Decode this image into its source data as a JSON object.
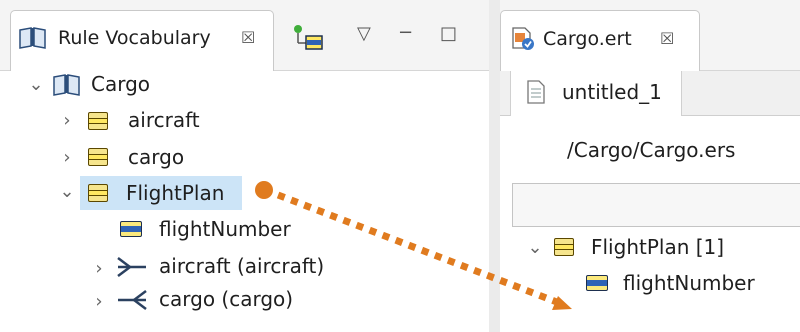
{
  "left_view": {
    "tab_title": "Rule Vocabulary",
    "tab_close": "☒",
    "toolbar": {
      "menu": "▽",
      "minimize": "−",
      "maximize": "□"
    },
    "tree": [
      {
        "label": "Cargo",
        "expanded": true
      },
      {
        "label": "aircraft",
        "expanded": false
      },
      {
        "label": "cargo",
        "expanded": false
      },
      {
        "label": "FlightPlan",
        "expanded": true,
        "selected": true
      },
      {
        "label": "flightNumber"
      },
      {
        "label": "aircraft (aircraft)",
        "expanded": false
      },
      {
        "label": "cargo (cargo)",
        "expanded": false
      }
    ]
  },
  "right_view": {
    "tab_title": "Cargo.ert",
    "tab_close": "☒",
    "sub_tab": "untitled_1",
    "path": "/Cargo/Cargo.ers",
    "tree": [
      {
        "label": "FlightPlan [1]",
        "expanded": true
      },
      {
        "label": "flightNumber"
      }
    ]
  },
  "annotation": {
    "color": "#e07b1f"
  }
}
